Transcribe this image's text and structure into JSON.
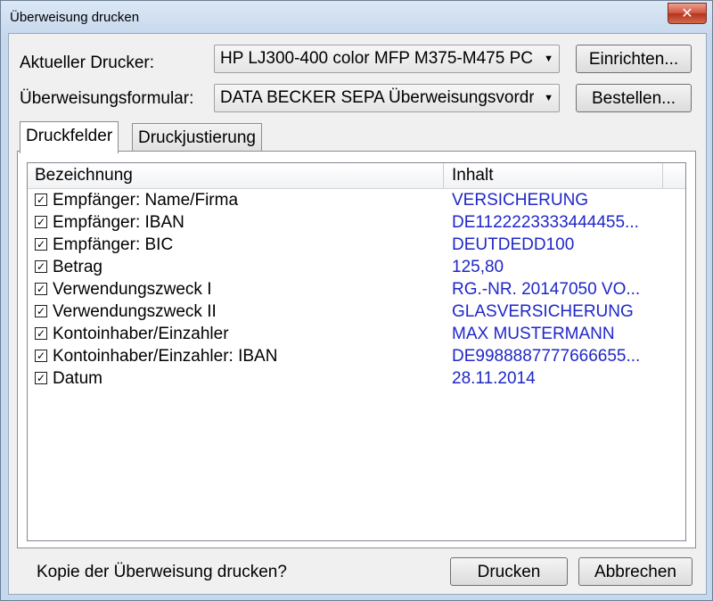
{
  "window": {
    "title": "Überweisung drucken",
    "close_glyph": "✕"
  },
  "printer": {
    "label": "Aktueller Drucker:",
    "value": "HP LJ300-400 color MFP M375-M475 PC",
    "button": "Einrichten..."
  },
  "form": {
    "label": "Überweisungsformular:",
    "value": "DATA BECKER SEPA Überweisungsvordruck",
    "button": "Bestellen..."
  },
  "tabs": [
    {
      "label": "Druckfelder",
      "active": true
    },
    {
      "label": "Druckjustierung",
      "active": false
    }
  ],
  "list": {
    "columns": [
      "Bezeichnung",
      "Inhalt"
    ],
    "rows": [
      {
        "checked": true,
        "name": "Empfänger: Name/Firma",
        "value": "VERSICHERUNG"
      },
      {
        "checked": true,
        "name": "Empfänger: IBAN",
        "value": "DE1122223333444455..."
      },
      {
        "checked": true,
        "name": "Empfänger: BIC",
        "value": "DEUTDEDD100"
      },
      {
        "checked": true,
        "name": "Betrag",
        "value": "125,80"
      },
      {
        "checked": true,
        "name": "Verwendungszweck I",
        "value": "RG.-NR. 20147050 VO..."
      },
      {
        "checked": true,
        "name": "Verwendungszweck II",
        "value": "GLASVERSICHERUNG"
      },
      {
        "checked": true,
        "name": "Kontoinhaber/Einzahler",
        "value": "MAX MUSTERMANN"
      },
      {
        "checked": true,
        "name": "Kontoinhaber/Einzahler: IBAN",
        "value": "DE9988887777666655..."
      },
      {
        "checked": true,
        "name": "Datum",
        "value": "28.11.2014"
      }
    ]
  },
  "footer": {
    "copy_label": "Kopie der Überweisung drucken?",
    "copy_checked": false,
    "print_button": "Drucken",
    "cancel_button": "Abbrechen"
  },
  "colors": {
    "value_text": "#1f27c8",
    "close_button": "#c9452e"
  },
  "icons": {
    "close": "close-icon",
    "dropdown": "chevron-down-icon",
    "check": "checkmark-icon"
  }
}
